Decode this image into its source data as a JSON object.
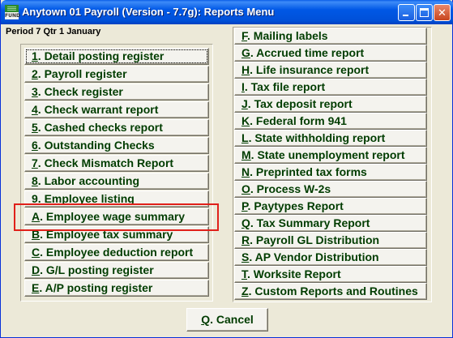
{
  "window": {
    "title": "Anytown 01 Payroll (Version - 7.7g):  Reports Menu",
    "app_icon_text": "FUND",
    "controls": {
      "minimize_icon": "minimize-icon",
      "maximize_icon": "maximize-icon",
      "close_icon": "close-icon",
      "close_glyph": "✕"
    }
  },
  "period": "Period 7 Qtr 1 January",
  "left_menu": [
    {
      "key": "1",
      "rest": ". Detail posting register",
      "focused": true
    },
    {
      "key": "2",
      "rest": ".  Payroll register"
    },
    {
      "key": "3",
      "rest": ". Check register"
    },
    {
      "key": "4",
      "rest": ". Check warrant report"
    },
    {
      "key": "5",
      "rest": ". Cashed checks report"
    },
    {
      "key": "6",
      "rest": ". Outstanding Checks"
    },
    {
      "key": "7",
      "rest": ". Check Mismatch Report"
    },
    {
      "key": "8",
      "rest": ". Labor accounting"
    },
    {
      "key": "9",
      "rest": ".  Employee listing"
    },
    {
      "key": "A",
      "rest": ". Employee wage summary",
      "highlighted": true
    },
    {
      "key": "B",
      "rest": ". Employee tax summary"
    },
    {
      "key": "C",
      "rest": ". Employee deduction report"
    },
    {
      "key": "D",
      "rest": ". G/L posting register"
    },
    {
      "key": "E",
      "rest": ". A/P posting register"
    }
  ],
  "right_menu": [
    {
      "key": "F",
      "rest": ".  Mailing labels"
    },
    {
      "key": "G",
      "rest": ". Accrued time report"
    },
    {
      "key": "H",
      "rest": ". Life insurance report"
    },
    {
      "key": "I",
      "rest": ". Tax file report"
    },
    {
      "key": "J",
      "rest": ". Tax deposit report"
    },
    {
      "key": "K",
      "rest": ". Federal form 941"
    },
    {
      "key": "L",
      "rest": ". State withholding report"
    },
    {
      "key": "M",
      "rest": ". State unemployment report"
    },
    {
      "key": "N",
      "rest": ". Preprinted tax forms"
    },
    {
      "key": "O",
      "rest": ". Process W-2s"
    },
    {
      "key": "P",
      "rest": ".  Paytypes Report"
    },
    {
      "key": "Q",
      "rest": ". Tax Summary Report"
    },
    {
      "key": "R",
      "rest": ". Payroll GL Distribution"
    },
    {
      "key": "S",
      "rest": ". AP Vendor Distribution"
    },
    {
      "key": "T",
      "rest": ". Worksite Report"
    },
    {
      "key": "Z",
      "rest": ". Custom Reports and Routines"
    }
  ],
  "cancel": {
    "key": "Q",
    "rest": ". Cancel"
  },
  "colors": {
    "title_bar": "#0058E6",
    "button_text": "#003C00",
    "highlight_border": "#E0201A",
    "window_bg": "#ECE9D8"
  }
}
